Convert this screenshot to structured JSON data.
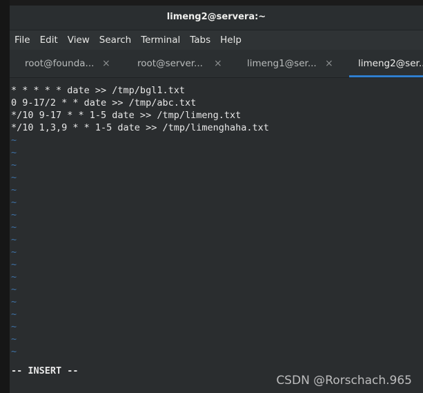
{
  "window": {
    "title": "limeng2@servera:~"
  },
  "menu": {
    "items": [
      "File",
      "Edit",
      "View",
      "Search",
      "Terminal",
      "Tabs",
      "Help"
    ]
  },
  "tabs": [
    {
      "label": "root@founda...",
      "close": "×",
      "active": false
    },
    {
      "label": "root@server...",
      "close": "×",
      "active": false
    },
    {
      "label": "limeng1@ser...",
      "close": "×",
      "active": false
    },
    {
      "label": "limeng2@ser...",
      "close": "",
      "active": true
    }
  ],
  "editor": {
    "lines": [
      "* * * * * date >> /tmp/bgl1.txt",
      "0 9-17/2 * * date >> /tmp/abc.txt",
      "*/10 9-17 * * 1-5 date >> /tmp/limeng.txt",
      "*/10 1,3,9 * * 1-5 date >> /tmp/limenghaha.txt"
    ],
    "empty_line_marker": "~",
    "mode": "-- INSERT --"
  },
  "watermark": "CSDN @Rorschach.965",
  "colors": {
    "active_tab_underline": "#2f7fd0",
    "tilde": "#3f73a8",
    "background": "#2a2d2f"
  }
}
